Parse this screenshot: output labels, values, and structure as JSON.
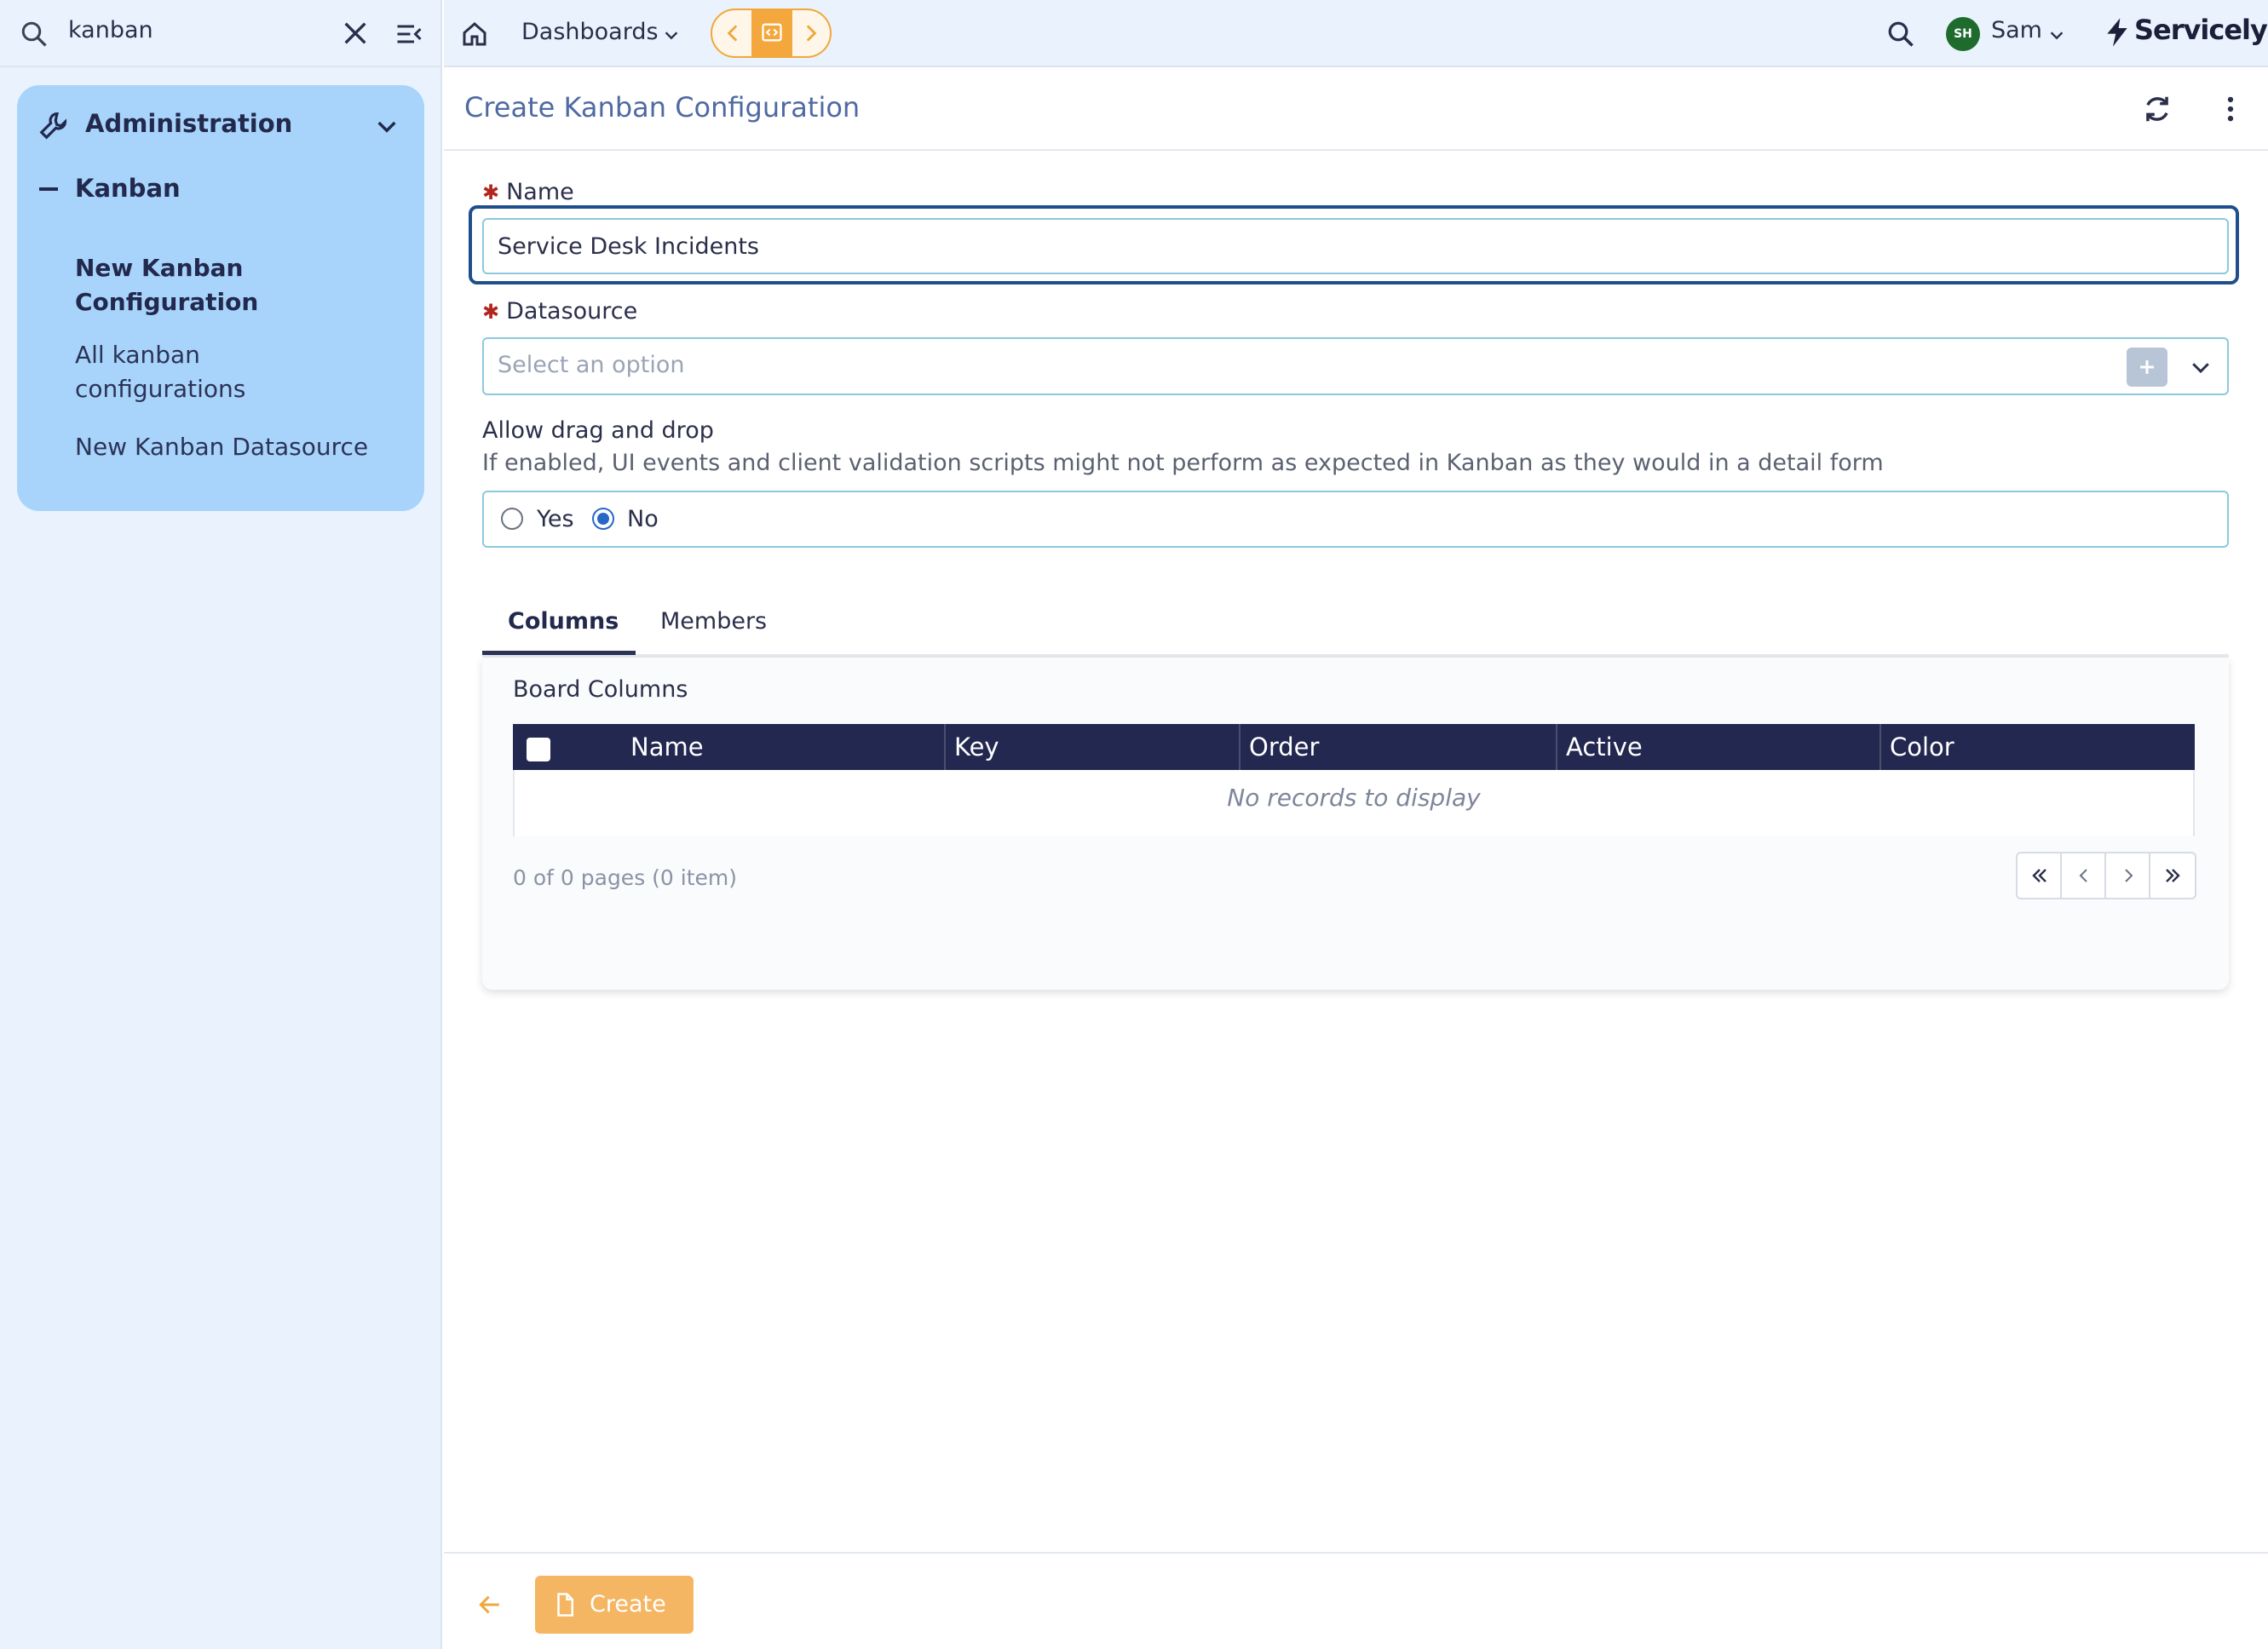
{
  "sidebar": {
    "search_value": "kanban",
    "section_title": "Administration",
    "group_title": "Kanban",
    "items": [
      {
        "label_line1": "New Kanban",
        "label_line2": "Configuration"
      },
      {
        "label_line1": "All kanban",
        "label_line2": "configurations"
      },
      {
        "label_line1": "New Kanban Datasource",
        "label_line2": ""
      }
    ]
  },
  "topbar": {
    "dashboards_label": "Dashboards",
    "avatar_initials": "SH",
    "user_name": "Sam",
    "logo_text": "Servicely"
  },
  "page": {
    "title": "Create Kanban Configuration"
  },
  "form": {
    "name_label": "Name",
    "name_value": "Service Desk Incidents",
    "datasource_label": "Datasource",
    "datasource_placeholder": "Select an option",
    "dnd_label": "Allow drag and drop",
    "dnd_help": "If enabled, UI events and client validation scripts might not perform as expected in Kanban as they would in a detail form",
    "dnd_options": [
      "Yes",
      "No"
    ],
    "dnd_selected": "No"
  },
  "tabs": [
    "Columns",
    "Members"
  ],
  "active_tab": "Columns",
  "columns_panel": {
    "title": "Board Columns",
    "headers": [
      "Name",
      "Key",
      "Order",
      "Active",
      "Color"
    ],
    "empty_text": "No records to display",
    "pager_info": "0 of 0 pages (0 item)"
  },
  "footer": {
    "create_label": "Create"
  },
  "colors": {
    "accent": "#f4a73c",
    "sidebar_bg": "#eaf3fd",
    "nav_card": "#a8d4fb",
    "grid_header": "#232850",
    "focus_ring": "#1f4e8c"
  }
}
